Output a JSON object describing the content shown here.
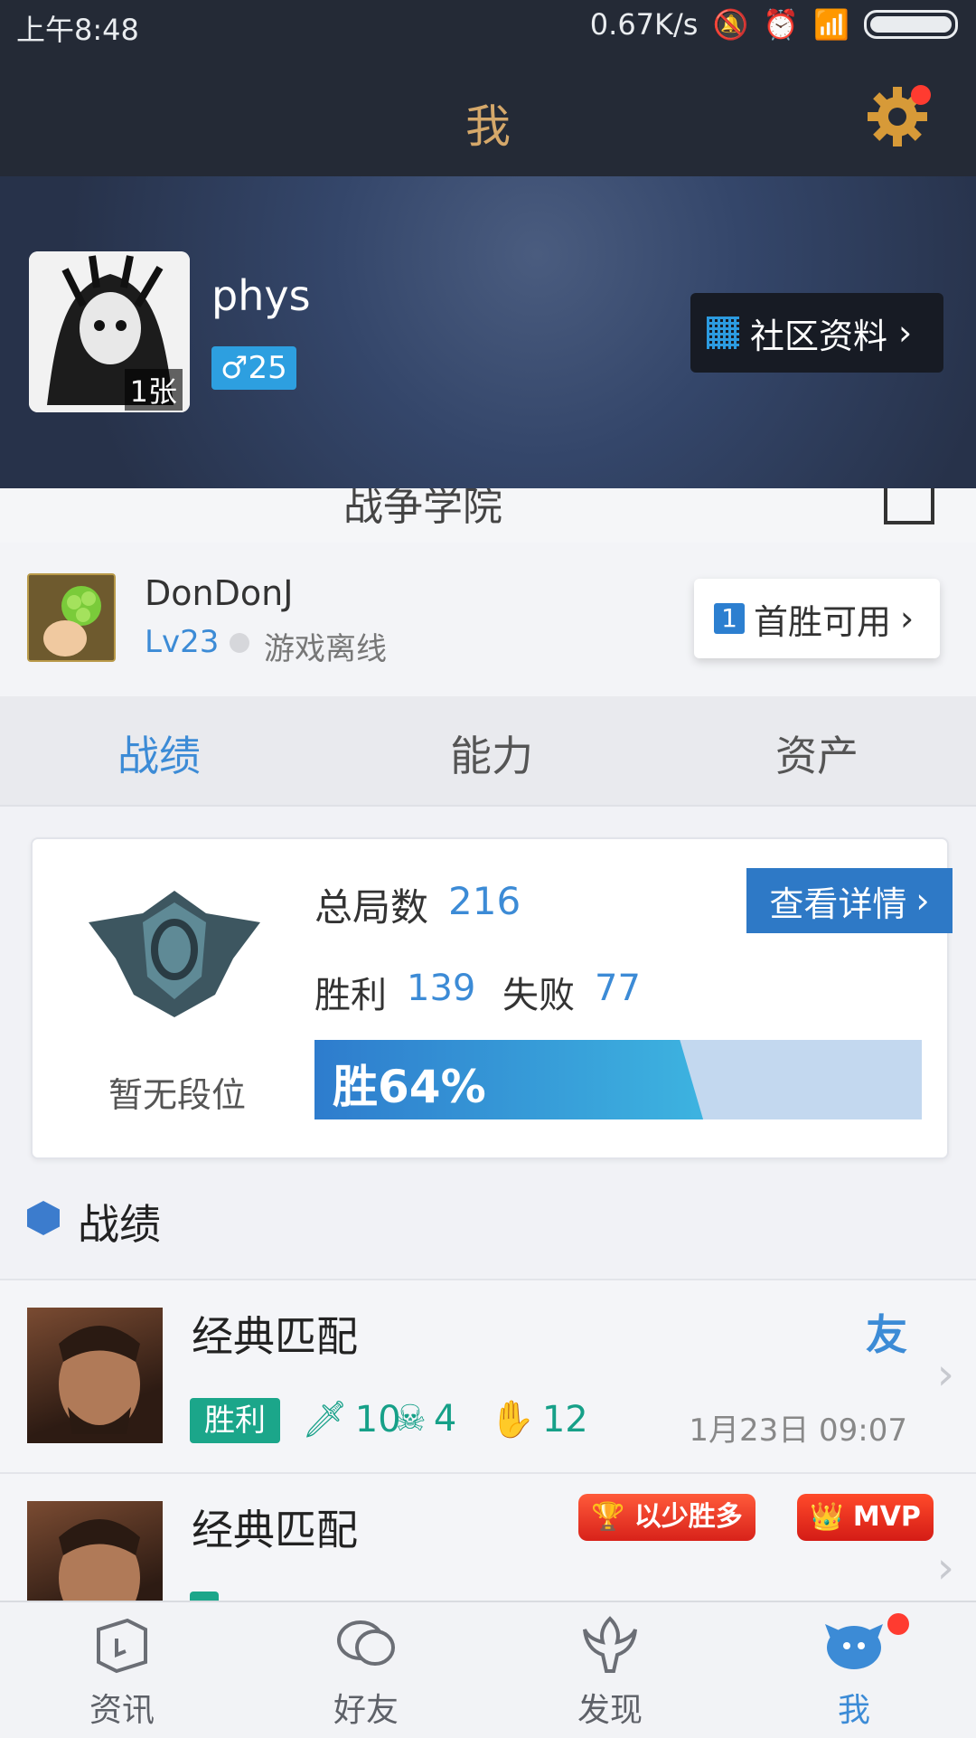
{
  "status_bar": {
    "time": "上午8:48",
    "speed": "0.67K/s"
  },
  "header": {
    "title": "我"
  },
  "profile": {
    "username": "phys",
    "age_badge": "♂25",
    "avatar_count": "1张",
    "community_button": "社区资料"
  },
  "peek_row": {
    "text": "战争学院"
  },
  "game_account": {
    "name": "DonDonJ",
    "level": "Lv23",
    "status": "游戏离线",
    "first_win_number": "1",
    "first_win_label": "首胜可用"
  },
  "tabs": [
    {
      "label": "战绩"
    },
    {
      "label": "能力"
    },
    {
      "label": "资产"
    }
  ],
  "stats": {
    "rank_label": "暂无段位",
    "total_label": "总局数",
    "total_value": "216",
    "win_label": "胜利",
    "win_value": "139",
    "lose_label": "失败",
    "lose_value": "77",
    "win_rate_text": "胜64%",
    "win_rate": 0.64,
    "detail_button": "查看详情"
  },
  "section": {
    "title": "战绩"
  },
  "matches": [
    {
      "title": "经典匹配",
      "friend_icon": "友",
      "result": "胜利",
      "kills": "10",
      "deaths": "4",
      "assists": "12",
      "time": "1月23日 09:07"
    },
    {
      "title": "经典匹配",
      "tags": [
        "以少胜多",
        "MVP"
      ]
    }
  ],
  "bottom_nav": [
    {
      "label": "资讯",
      "icon": "book-icon"
    },
    {
      "label": "好友",
      "icon": "chat-bubble-icon"
    },
    {
      "label": "发现",
      "icon": "spirit-icon"
    },
    {
      "label": "我",
      "icon": "poro-icon"
    }
  ],
  "colors": {
    "accent": "#3c8bd6",
    "header_bg": "#242a36",
    "win_green": "#1ba68a",
    "notify_red": "#ff3b30"
  }
}
